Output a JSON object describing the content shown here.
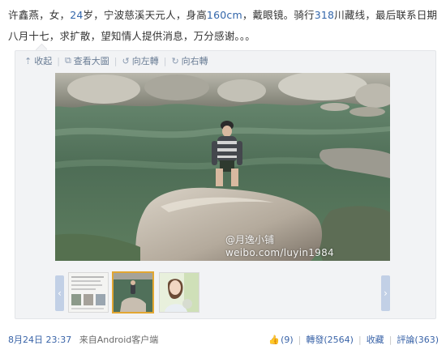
{
  "post": {
    "text_before_1": "许鑫燕，女，",
    "age": "24",
    "text_between_1": "岁，宁波慈溪天元人，身高",
    "height": "160cm",
    "text_between_2": "，戴眼镜。骑行",
    "route_num": "318",
    "text_after": "川藏线，最后联系日期八月十七，求扩散，望知情人提供消息，万分感谢。。。"
  },
  "toolbar": {
    "collapse_label": "收起",
    "view_large_label": "查看大圖",
    "rotate_left_label": "向左轉",
    "rotate_right_label": "向右轉"
  },
  "watermark": {
    "handle": "@月逸小铺",
    "url": "weibo.com/luyin1984"
  },
  "meta": {
    "time": "8月24日 23:37",
    "source": "来自Android客户端"
  },
  "actions": {
    "like_count": "(9)",
    "repost_label": "轉發(2564)",
    "favorite_label": "收藏",
    "comment_label": "評論(363)"
  },
  "icons": [
    "collapse-icon",
    "view-large-icon",
    "rotate-left-icon",
    "rotate-right-icon",
    "thumbs-up-icon",
    "prev-arrow-icon",
    "next-arrow-icon"
  ],
  "colors": {
    "link": "#3a64a8",
    "accent_border": "#e2a632",
    "nav": "#c2d0e6"
  }
}
